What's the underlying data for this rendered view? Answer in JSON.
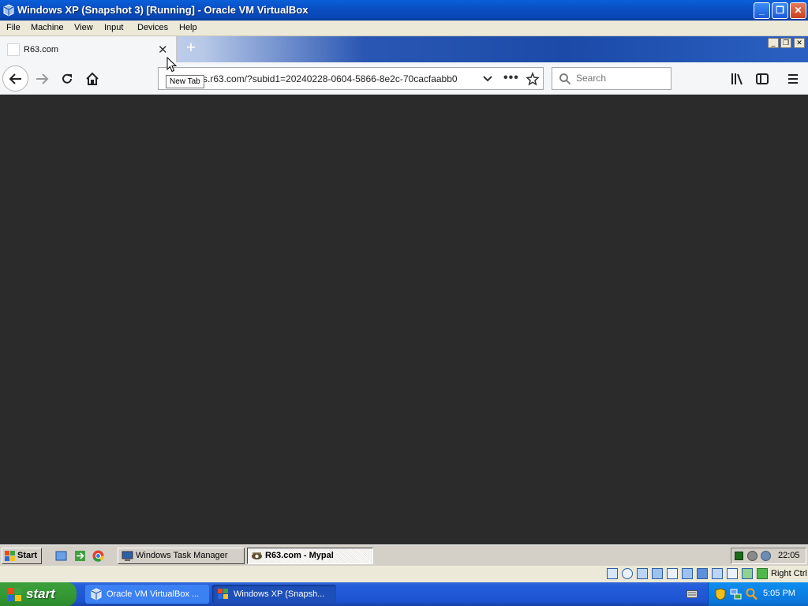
{
  "host_window": {
    "title": "Windows XP (Snapshot 3) [Running] - Oracle VM VirtualBox",
    "menu": [
      "File",
      "Machine",
      "View",
      "Input",
      "Devices",
      "Help"
    ]
  },
  "browser": {
    "tab_title": "R63.com",
    "new_tab_tooltip": "New Tab",
    "url": "s.r63.com/?subid1=20240228-0604-5866-8e2c-70cacfaabb0",
    "search_placeholder": "Search"
  },
  "guest_taskbar": {
    "start_label": "Start",
    "tasks": [
      "Windows Task Manager",
      "R63.com - Mypal"
    ],
    "clock": "22:05"
  },
  "vbox_status": {
    "host_key": "Right Ctrl"
  },
  "host_taskbar": {
    "start_label": "start",
    "tasks": [
      "Oracle VM VirtualBox ...",
      "Windows XP (Snapsh..."
    ],
    "clock": "5:05 PM"
  },
  "colors": {
    "content_bg": "#2b2b2b",
    "xp_blue": "#245edb",
    "xp_green": "#369c36"
  }
}
